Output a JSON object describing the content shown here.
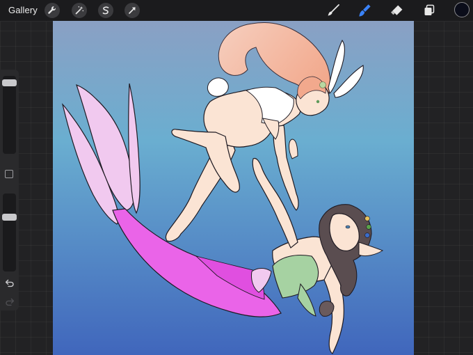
{
  "toolbar": {
    "gallery_label": "Gallery",
    "left_tools": [
      "wrench-icon",
      "magic-wand-icon",
      "selection-icon",
      "transform-arrow-icon"
    ],
    "right_tools": [
      "brush-icon",
      "smudge-icon",
      "eraser-icon",
      "layers-icon",
      "color-swatch"
    ]
  },
  "colors": {
    "active_tool": "#3a82f7",
    "current_color": "#0b0d1a",
    "canvas_top": "#8aa0c4",
    "canvas_mid": "#6aaed0",
    "canvas_bottom": "#4066bc"
  },
  "sidebar": {
    "brush_size_level": 0.05,
    "opacity_level": 0.28
  }
}
